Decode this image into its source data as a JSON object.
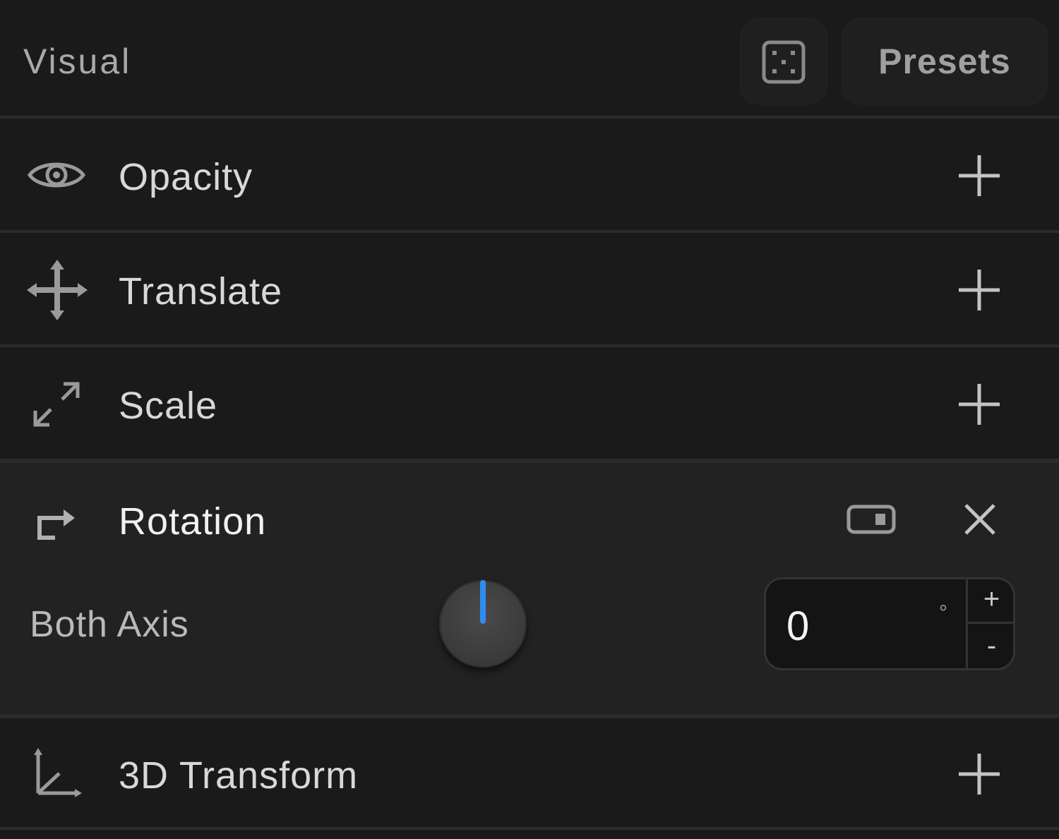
{
  "header": {
    "title": "Visual",
    "dice_icon": "dice-icon",
    "presets_label": "Presets"
  },
  "properties": [
    {
      "label": "Opacity",
      "icon": "eye-icon",
      "action_icon": "plus-icon"
    },
    {
      "label": "Translate",
      "icon": "move-arrows-icon",
      "action_icon": "plus-icon"
    },
    {
      "label": "Scale",
      "icon": "scale-arrows-icon",
      "action_icon": "plus-icon"
    },
    {
      "label": "Rotation",
      "icon": "rotate-icon",
      "action_icons": [
        "toggle-icon",
        "close-icon"
      ],
      "expanded": true
    },
    {
      "label": "3D Transform",
      "icon": "axes-3d-icon",
      "action_icon": "plus-icon"
    }
  ],
  "rotation": {
    "axis_label": "Both Axis",
    "value": "0",
    "unit": "°",
    "increment_label": "+",
    "decrement_label": "-"
  },
  "colors": {
    "background": "#1a1a1a",
    "expanded_background": "#222222",
    "dial_accent": "#2f8cf0"
  }
}
